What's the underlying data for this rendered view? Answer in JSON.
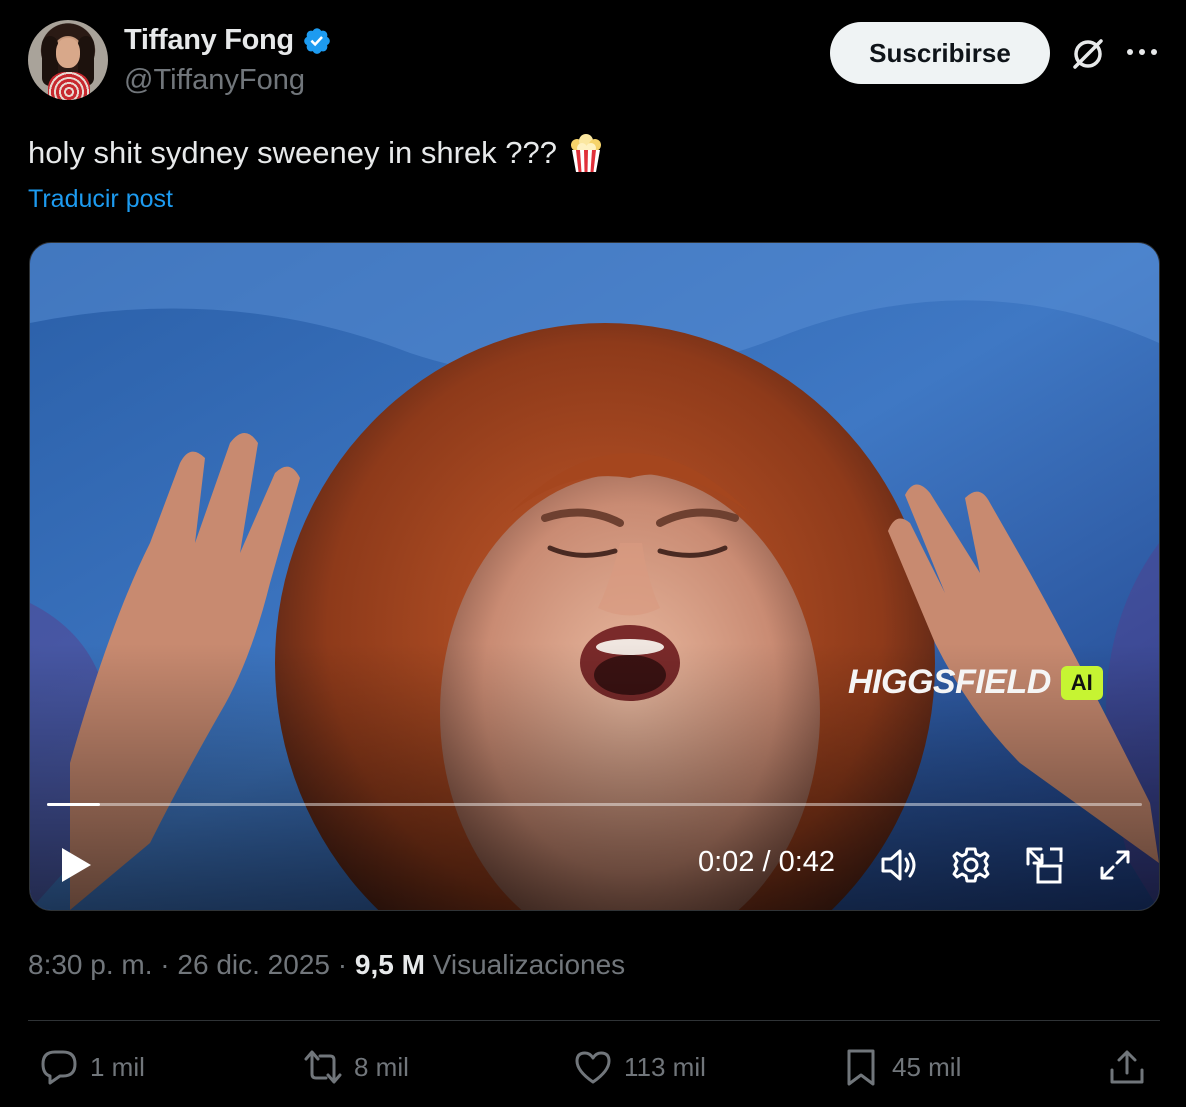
{
  "author": {
    "name": "Tiffany Fong",
    "handle": "@TiffanyFong",
    "verified": true
  },
  "header": {
    "subscribe_label": "Suscribirse",
    "icons": [
      "grok-icon",
      "more-icon"
    ]
  },
  "post": {
    "text": "holy shit sydney sweeney in shrek ???",
    "emoji": "popcorn",
    "translate_label": "Traducir post"
  },
  "video": {
    "watermark_text": "HIGGSFIELD",
    "watermark_badge": "AI",
    "watermark_badge_color": "#c6f432",
    "timecode": "0:02 / 0:42",
    "progress_fraction": 0.048,
    "controls": [
      "play-icon",
      "volume-icon",
      "settings-icon",
      "pip-icon",
      "fullscreen-icon"
    ]
  },
  "meta": {
    "time": "8:30 p. m.",
    "separator": "·",
    "date": "26 dic. 2025",
    "views_count": "9,5 M",
    "views_label": "Visualizaciones"
  },
  "actions": {
    "replies": "1 mil",
    "reposts": "8 mil",
    "likes": "113 mil",
    "bookmarks": "45 mil"
  },
  "colors": {
    "background": "#000000",
    "text": "#e7e9ea",
    "muted": "#71767b",
    "link": "#1d9bf0",
    "verified": "#1d9bf0"
  }
}
